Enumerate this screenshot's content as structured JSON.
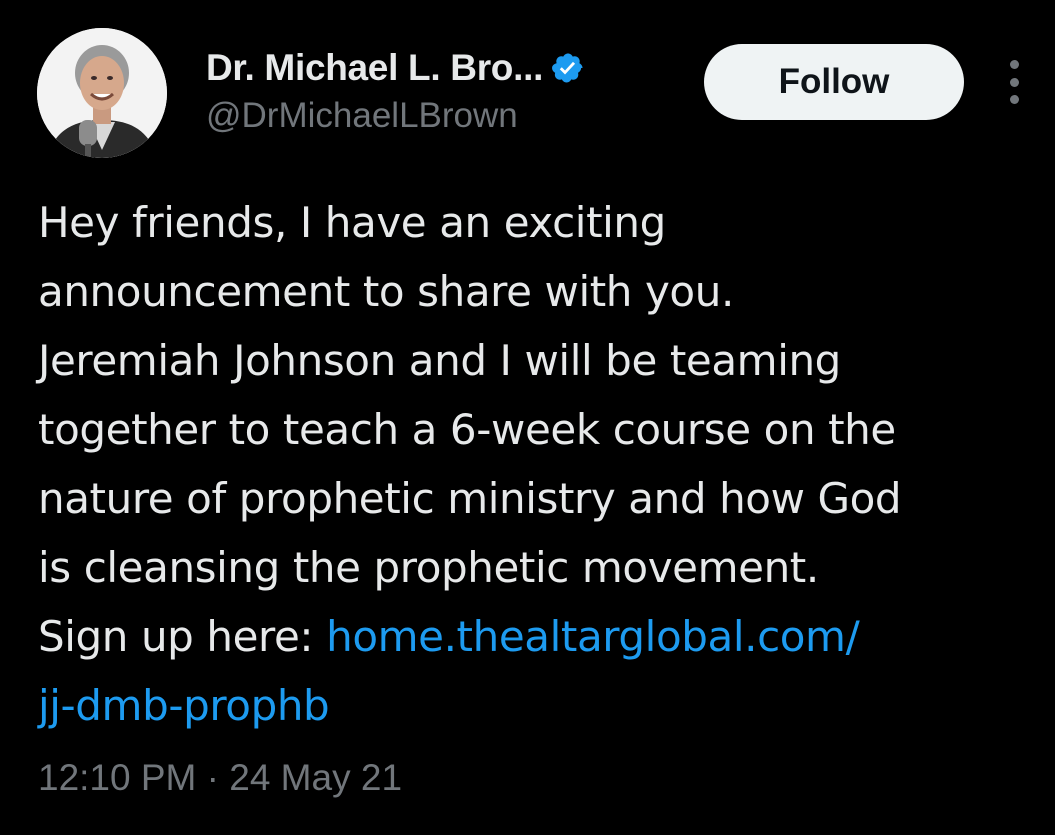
{
  "author": {
    "display_name": "Dr. Michael L. Bro...",
    "handle": "@DrMichaelLBrown",
    "verified_icon": "verified-badge-icon",
    "verified_color": "#1d9bf0"
  },
  "actions": {
    "follow_label": "Follow",
    "more_icon": "more-vertical-icon"
  },
  "tweet": {
    "lines": [
      "Hey friends, I have an exciting",
      "announcement to share with you.",
      "Jeremiah Johnson and I will be teaming",
      "together to teach a 6-week course on the",
      "nature of prophetic ministry and how God",
      "is cleansing the prophetic movement."
    ],
    "signup_prefix": "Sign up here: ",
    "link_line1": "home.thealtarglobal.com/",
    "link_line2": "jj-dmb-prophb",
    "timestamp": "12:10 PM · 24 May 21"
  },
  "colors": {
    "background": "#000000",
    "text": "#e7e9ea",
    "secondary": "#71767b",
    "link": "#1d9bf0",
    "follow_bg": "#eff3f4"
  }
}
